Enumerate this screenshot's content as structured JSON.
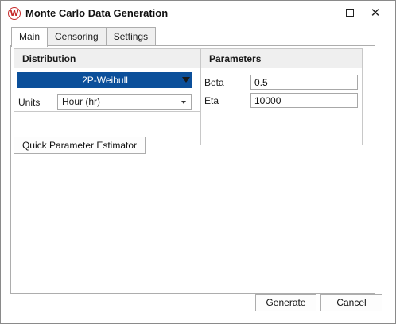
{
  "window": {
    "title": "Monte Carlo Data Generation",
    "app_icon_letter": "W",
    "maximize_icon": "maximize-icon",
    "close_icon": "close-icon",
    "close_glyph": "✕"
  },
  "tabs": [
    {
      "label": "Main",
      "active": true
    },
    {
      "label": "Censoring",
      "active": false
    },
    {
      "label": "Settings",
      "active": false
    }
  ],
  "distribution": {
    "header": "Distribution",
    "selected": "2P-Weibull",
    "units_label": "Units",
    "units_value": "Hour (hr)"
  },
  "parameters": {
    "header": "Parameters",
    "beta_label": "Beta",
    "beta_value": "0.5",
    "eta_label": "Eta",
    "eta_value": "10000"
  },
  "buttons": {
    "quick_parameter_estimator": "Quick Parameter Estimator",
    "generate": "Generate",
    "cancel": "Cancel"
  },
  "colors": {
    "selection_accent": "#0b4f9a",
    "app_icon": "#c62828"
  }
}
